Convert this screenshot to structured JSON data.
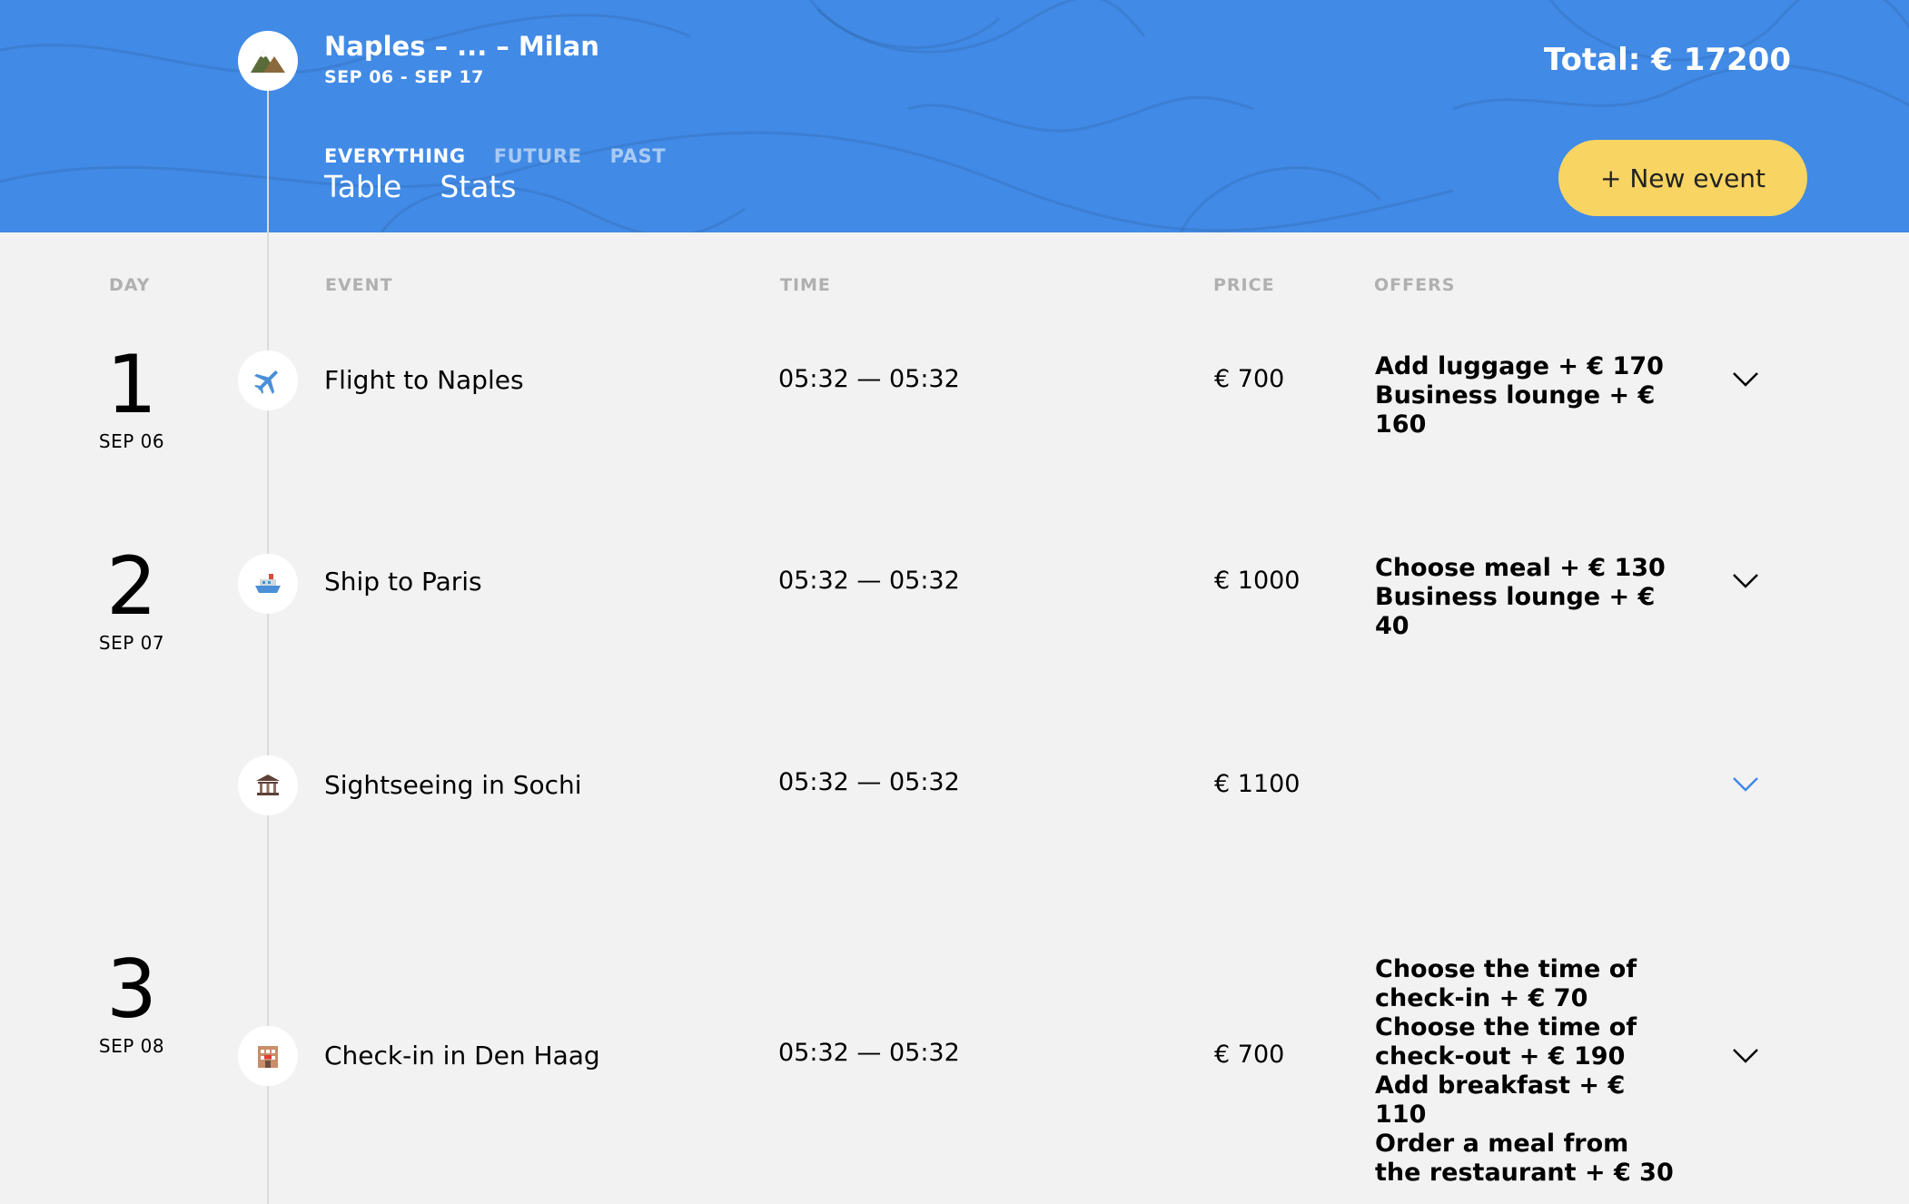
{
  "header": {
    "trip_title": "Naples – ... – Milan",
    "trip_dates": "SEP 06 - SEP 17",
    "total": "Total: € 17200",
    "filters": [
      {
        "label": "EVERYTHING",
        "active": true
      },
      {
        "label": "FUTURE",
        "active": false
      },
      {
        "label": "PAST",
        "active": false
      }
    ],
    "views": [
      "Table",
      "Stats"
    ],
    "new_event_label": "+ New event",
    "logo_icon": "mountain-icon"
  },
  "columns": {
    "day": "DAY",
    "event": "EVENT",
    "time": "TIME",
    "price": "PRICE",
    "offers": "OFFERS"
  },
  "days": [
    {
      "number": "1",
      "date": "SEP 06"
    },
    {
      "number": "2",
      "date": "SEP 07"
    },
    {
      "number": "3",
      "date": "SEP 08"
    }
  ],
  "events": [
    {
      "icon": "airplane-icon",
      "name": "Flight to Naples",
      "time": "05:32 — 05:32",
      "price": "€ 700",
      "offers": [
        "Add luggage + € 170",
        "Business lounge + € 160"
      ]
    },
    {
      "icon": "ship-icon",
      "name": "Ship to Paris",
      "time": "05:32 — 05:32",
      "price": "€ 1000",
      "offers": [
        "Choose meal + € 130",
        "Business lounge + € 40"
      ]
    },
    {
      "icon": "museum-icon",
      "name": "Sightseeing in Sochi",
      "time": "05:32 — 05:32",
      "price": "€ 1100",
      "offers": []
    },
    {
      "icon": "hotel-icon",
      "name": "Check-in in Den Haag",
      "time": "05:32 — 05:32",
      "price": "€ 700",
      "offers": [
        "Choose the time of check-in + € 70",
        "Choose the time of check-out + € 190",
        "Add breakfast + € 110",
        "Order a meal from the restaurant + € 30"
      ]
    }
  ],
  "colors": {
    "header_bg": "#418ae6",
    "button_bg": "#f8d463",
    "page_bg": "#f2f2f2",
    "chevron_active": "#418ae6"
  }
}
